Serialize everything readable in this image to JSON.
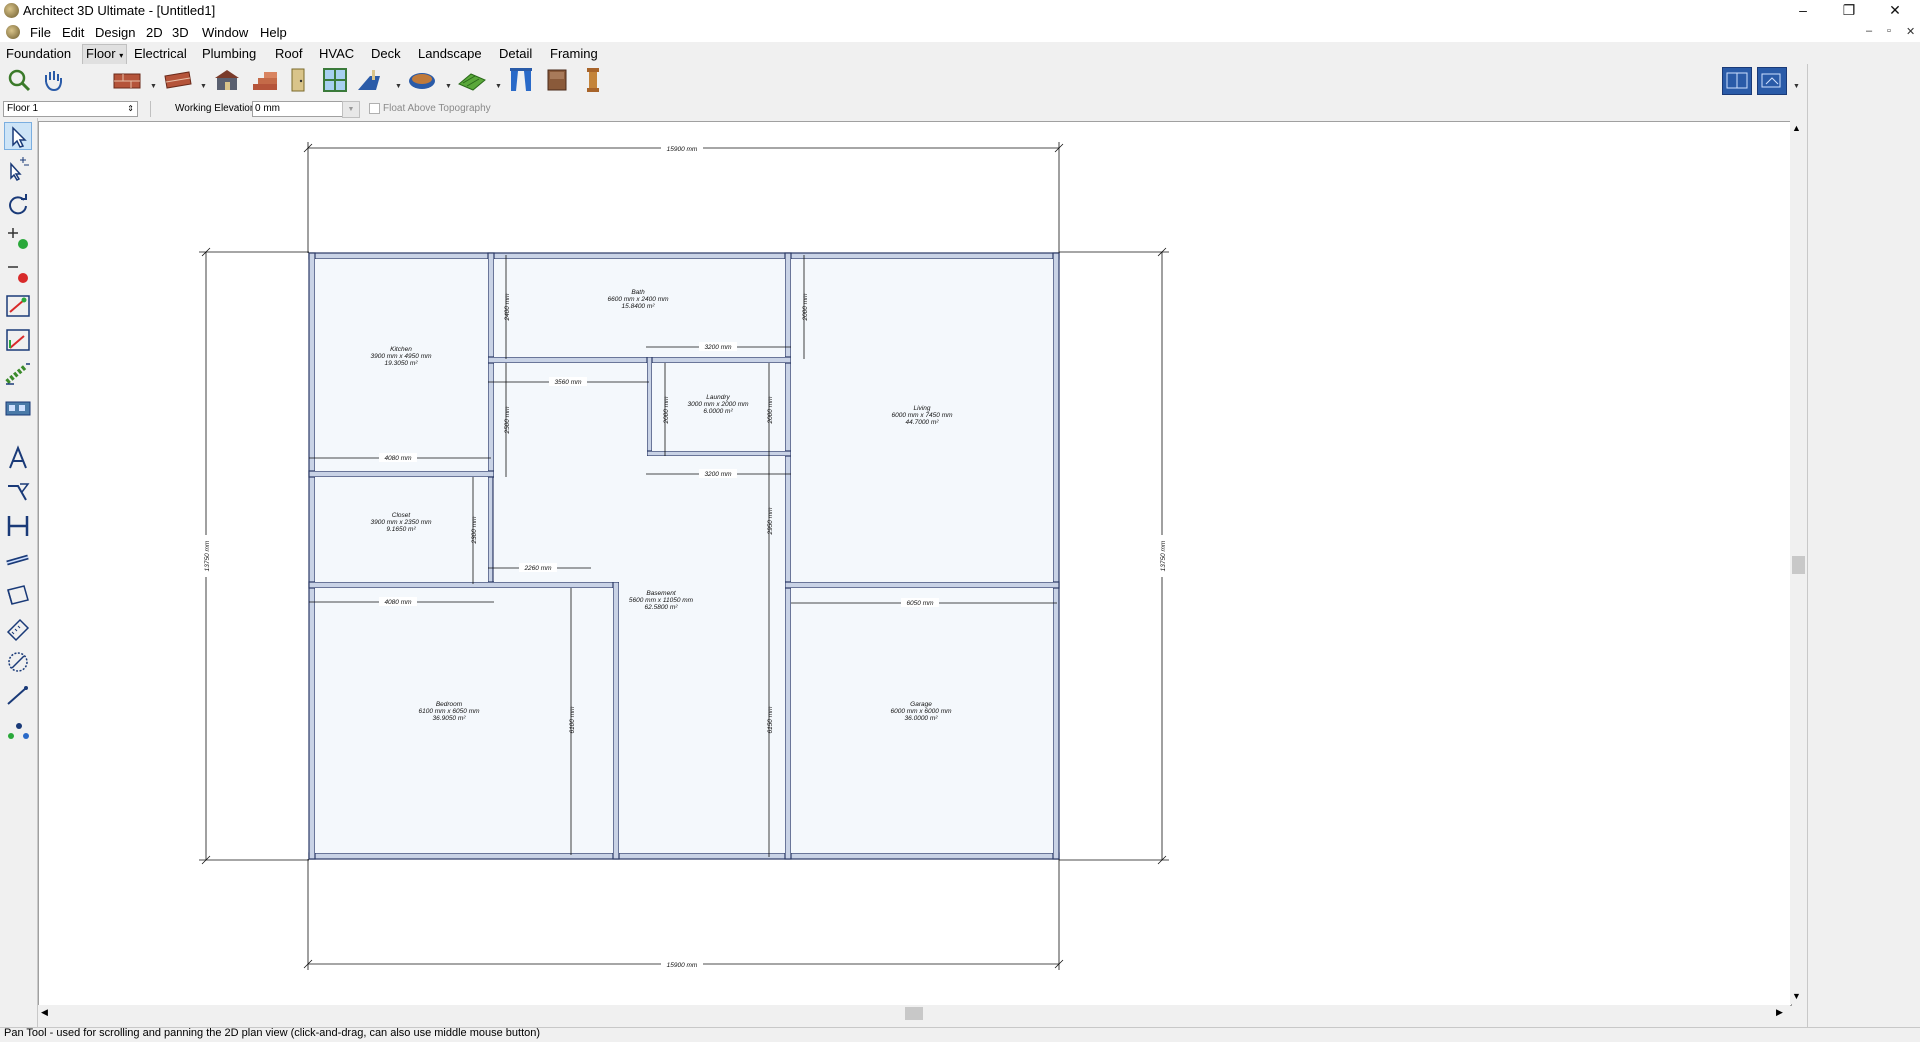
{
  "window": {
    "title": "Architect 3D Ultimate - [Untitled1]",
    "minimize": "–",
    "restore": "❐",
    "close": "✕"
  },
  "menu": [
    "File",
    "Edit",
    "Design",
    "2D",
    "3D",
    "Window",
    "Help"
  ],
  "mdi_controls": {
    "minimize": "–",
    "restore": "▫",
    "close": "✕"
  },
  "categories": [
    "Foundation",
    "Floor",
    "Electrical",
    "Plumbing",
    "Roof",
    "HVAC",
    "Deck",
    "Landscape",
    "Detail",
    "Framing"
  ],
  "categories_active": "Floor",
  "options": {
    "floor_selected": "Floor 1",
    "working_elevation_label": "Working Elevation:",
    "working_elevation_value": "0 mm",
    "float_label": "Float Above Topography"
  },
  "status": "Pan Tool - used for scrolling and panning the 2D plan view (click-and-drag, can also use middle mouse button)",
  "plan": {
    "overall_width": "15900 mm",
    "overall_height": "13750 mm",
    "rooms": [
      {
        "name": "Kitchen",
        "size": "3900 mm x 4950 mm",
        "area": "19.3050 m²"
      },
      {
        "name": "Bath",
        "size": "6600 mm x 2400 mm",
        "area": "15.8400 m²"
      },
      {
        "name": "Laundry",
        "size": "3000 mm x 2000 mm",
        "area": "6.0000 m²"
      },
      {
        "name": "Living",
        "size": "6000 mm x 7450 mm",
        "area": "44.7000 m²"
      },
      {
        "name": "Closet",
        "size": "3900 mm x 2350 mm",
        "area": "9.1650 m²"
      },
      {
        "name": "Basement",
        "size": "5600 mm x 11050 mm",
        "area": "62.5800 m²"
      },
      {
        "name": "Bedroom",
        "size": "6100 mm x 6050 mm",
        "area": "36.9050 m²"
      },
      {
        "name": "Garage",
        "size": "6000 mm x 6000 mm",
        "area": "36.0000 m²"
      }
    ],
    "dims": {
      "d2400": "2400 mm",
      "d2000": "2000 mm",
      "d3200": "3200 mm",
      "d3560": "3560 mm",
      "d2500": "2500 mm",
      "d4080": "4080 mm",
      "d2300": "2300 mm",
      "d2260": "2260 mm",
      "d2950": "2950 mm",
      "d6050": "6050 mm",
      "d6100": "6100 mm",
      "d6150": "6150 mm"
    }
  },
  "icons": {
    "left": [
      "select-arrow-icon",
      "multi-select-icon",
      "rotate-icon",
      "add-point-icon",
      "remove-point-icon",
      "edit-area-icon",
      "edit-area2-icon",
      "wall-stretch-icon",
      "wall-elev-icon",
      "text-icon",
      "callout-icon",
      "dimension-icon",
      "length-icon",
      "room-box-icon",
      "ruler-icon",
      "circle-dim-icon",
      "line-icon",
      "points-icon"
    ]
  },
  "colors": {
    "wall_fill": "#c9d3e6",
    "wall_stroke": "#2b3a66",
    "room_fill": "#f4f8fc",
    "accent": "#0b74d1"
  }
}
